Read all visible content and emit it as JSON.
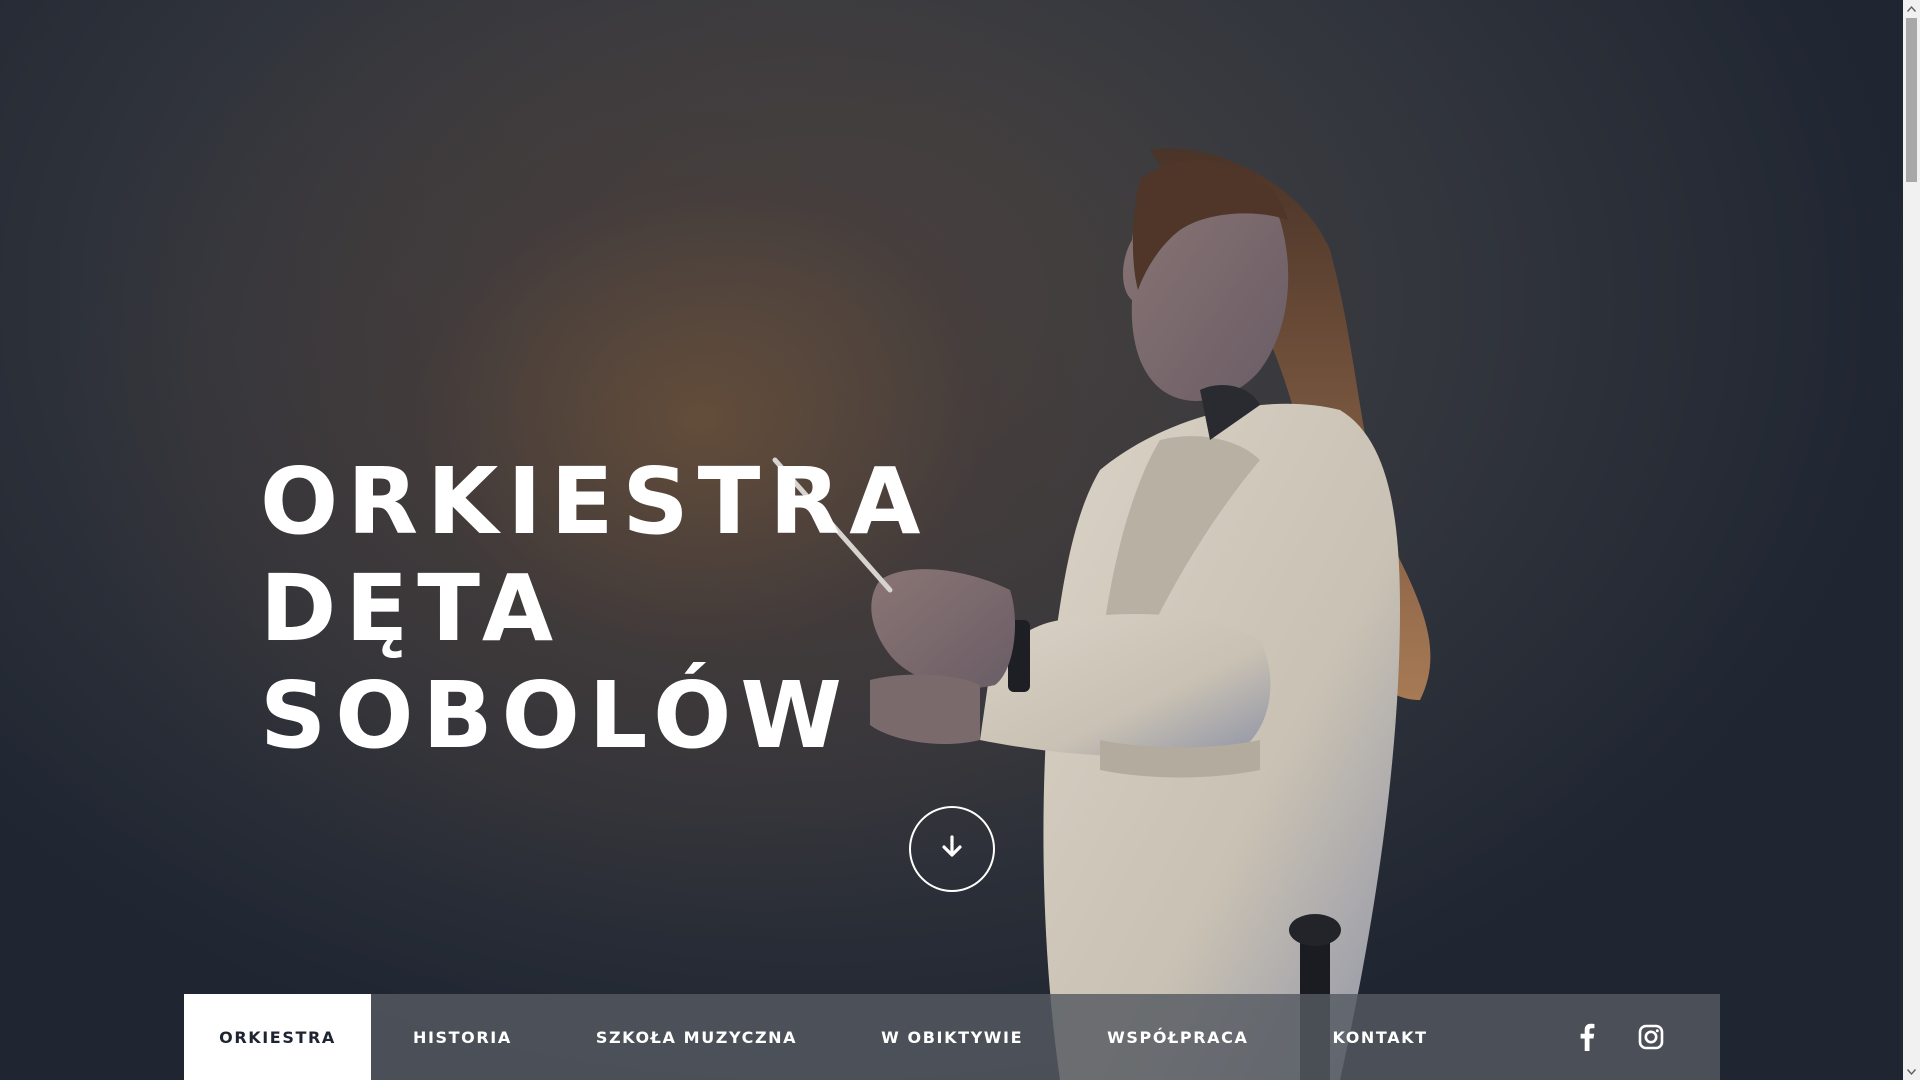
{
  "hero": {
    "title_lines": [
      "ORKIESTRA",
      "DĘTA",
      "SOBOLÓW"
    ],
    "scroll_icon": "arrow-down-icon"
  },
  "nav": {
    "items": [
      {
        "label": "ORKIESTRA",
        "active": true
      },
      {
        "label": "HISTORIA",
        "active": false
      },
      {
        "label": "SZKOŁA MUZYCZNA",
        "active": false
      },
      {
        "label": "W OBIKTYWIE",
        "active": false
      },
      {
        "label": "WSPÓŁPRACA",
        "active": false
      },
      {
        "label": "KONTAKT",
        "active": false
      }
    ],
    "social": [
      {
        "icon": "facebook-icon"
      },
      {
        "icon": "instagram-icon"
      }
    ]
  },
  "colors": {
    "background_dark": "#1f2531",
    "nav_bar": "#565a62",
    "nav_active_bg": "#ffffff",
    "text": "#ffffff"
  }
}
